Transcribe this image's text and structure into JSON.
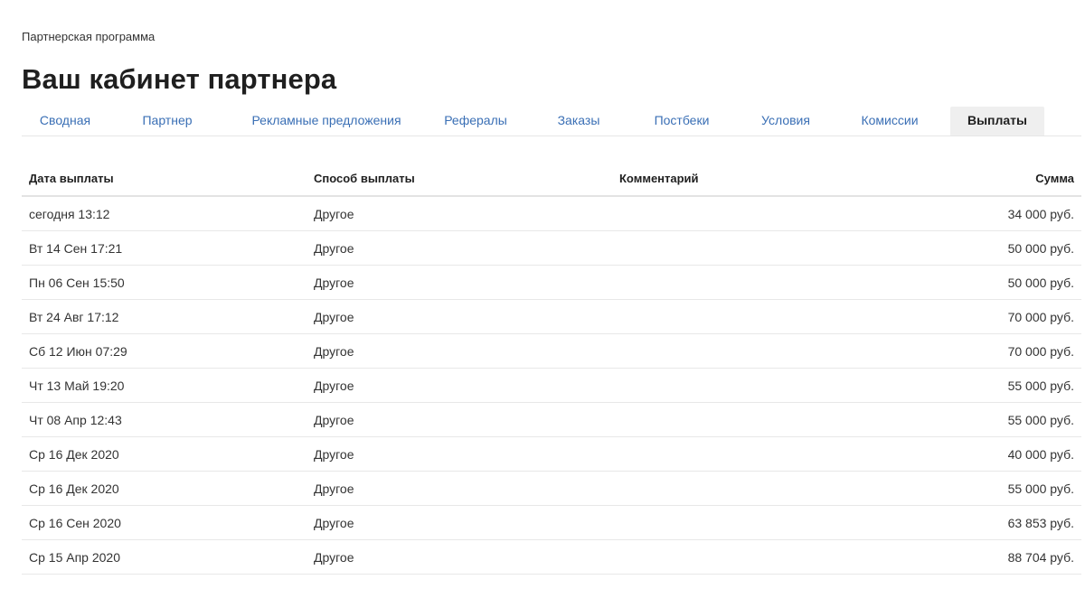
{
  "breadcrumb": "Партнерская программа",
  "title": "Ваш кабинет партнера",
  "tabs": [
    {
      "label": "Сводная",
      "active": false
    },
    {
      "label": "Партнер",
      "active": false
    },
    {
      "label": "Рекламные предложения",
      "active": false
    },
    {
      "label": "Рефералы",
      "active": false
    },
    {
      "label": "Заказы",
      "active": false
    },
    {
      "label": "Постбеки",
      "active": false
    },
    {
      "label": "Условия",
      "active": false
    },
    {
      "label": "Комиссии",
      "active": false
    },
    {
      "label": "Выплаты",
      "active": true
    }
  ],
  "table": {
    "headers": {
      "date": "Дата выплаты",
      "method": "Способ выплаты",
      "comment": "Комментарий",
      "amount": "Сумма"
    },
    "rows": [
      {
        "date": "сегодня 13:12",
        "method": "Другое",
        "comment": "",
        "amount": "34 000 руб."
      },
      {
        "date": "Вт 14 Сен 17:21",
        "method": "Другое",
        "comment": "",
        "amount": "50 000 руб."
      },
      {
        "date": "Пн 06 Сен 15:50",
        "method": "Другое",
        "comment": "",
        "amount": "50 000 руб."
      },
      {
        "date": "Вт 24 Авг 17:12",
        "method": "Другое",
        "comment": "",
        "amount": "70 000 руб."
      },
      {
        "date": "Сб 12 Июн 07:29",
        "method": "Другое",
        "comment": "",
        "amount": "70 000 руб."
      },
      {
        "date": "Чт 13 Май 19:20",
        "method": "Другое",
        "comment": "",
        "amount": "55 000 руб."
      },
      {
        "date": "Чт 08 Апр 12:43",
        "method": "Другое",
        "comment": "",
        "amount": "55 000 руб."
      },
      {
        "date": "Ср 16 Дек 2020",
        "method": "Другое",
        "comment": "",
        "amount": "40 000 руб."
      },
      {
        "date": "Ср 16 Дек 2020",
        "method": "Другое",
        "comment": "",
        "amount": "55 000 руб."
      },
      {
        "date": "Ср 16 Сен 2020",
        "method": "Другое",
        "comment": "",
        "amount": "63 853 руб."
      },
      {
        "date": "Ср 15 Апр 2020",
        "method": "Другое",
        "comment": "",
        "amount": "88 704 руб."
      }
    ]
  }
}
